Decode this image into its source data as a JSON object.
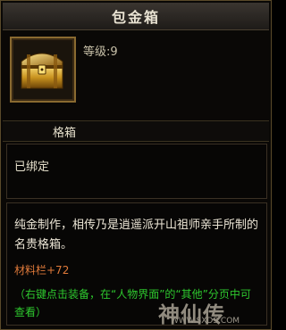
{
  "title": "包金箱",
  "item": {
    "icon": "golden-chest-icon",
    "level_label": "等级:",
    "level_value": "9",
    "category": "格箱",
    "bound_status": "已绑定",
    "description": "纯金制作，相传乃是逍遥派开山祖师亲手所制的名贵格箱。",
    "attribute": "材料栏+72",
    "hint": "（右键点击装备，在“人物界面”的“其他”分页中可查看）"
  },
  "watermark": {
    "logo": "神仙传",
    "url": "WWW.SXDS.COM"
  },
  "colors": {
    "background": "#0a0806",
    "border": "#5a4a2a",
    "attribute": "#e07a3a",
    "hint": "#2ec82e"
  }
}
